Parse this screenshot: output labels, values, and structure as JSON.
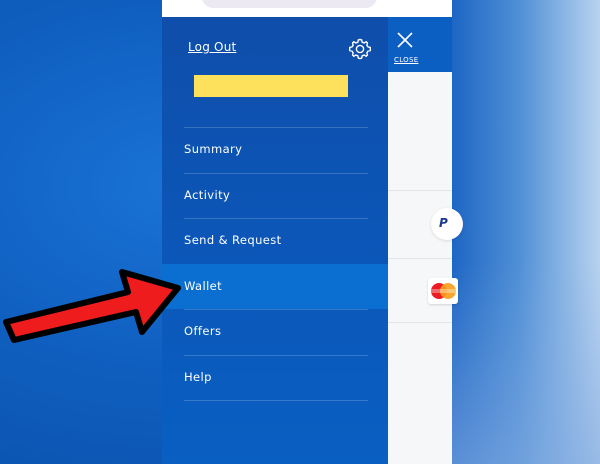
{
  "drawer": {
    "logout_label": "Log Out",
    "gear_icon": "gear-icon",
    "name_highlight_color": "#fde15c",
    "menu": [
      {
        "label": "Summary",
        "active": false
      },
      {
        "label": "Activity",
        "active": false
      },
      {
        "label": "Send & Request",
        "active": false
      },
      {
        "label": "Wallet",
        "active": true
      },
      {
        "label": "Offers",
        "active": false
      },
      {
        "label": "Help",
        "active": false
      }
    ]
  },
  "close_panel": {
    "label": "CLOSE",
    "icon": "close-icon"
  },
  "background_cards": {
    "paypal_badge_text": "P",
    "mastercard_icon": "mastercard-icon"
  },
  "overlay": {
    "arrow_icon": "red-arrow-icon",
    "arrow_color": "#ee1c1c"
  },
  "colors": {
    "drawer_blue": "#0f4eaa",
    "active_item": "#0a6fd0"
  }
}
